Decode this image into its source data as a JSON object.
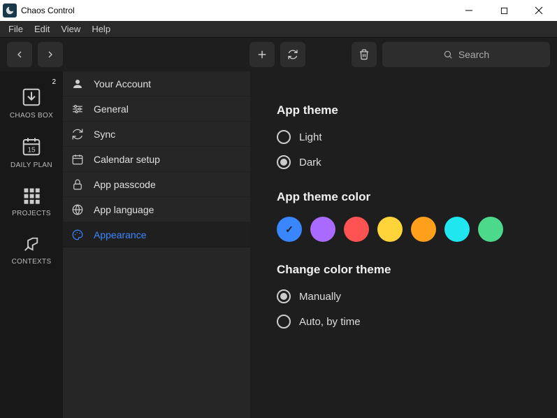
{
  "titlebar": {
    "title": "Chaos Control"
  },
  "menubar": [
    "File",
    "Edit",
    "View",
    "Help"
  ],
  "search": {
    "placeholder": "Search"
  },
  "leftnav": [
    {
      "label": "CHAOS BOX",
      "icon": "inbox",
      "badge": "2"
    },
    {
      "label": "DAILY PLAN",
      "icon": "calendar-day",
      "day": "15"
    },
    {
      "label": "PROJECTS",
      "icon": "grid"
    },
    {
      "label": "CONTEXTS",
      "icon": "pin"
    }
  ],
  "settingsnav": [
    {
      "label": "Your Account",
      "icon": "user"
    },
    {
      "label": "General",
      "icon": "sliders"
    },
    {
      "label": "Sync",
      "icon": "sync"
    },
    {
      "label": "Calendar setup",
      "icon": "calendar"
    },
    {
      "label": "App passcode",
      "icon": "lock"
    },
    {
      "label": "App language",
      "icon": "globe"
    },
    {
      "label": "Appearance",
      "icon": "palette",
      "active": true
    }
  ],
  "content": {
    "theme_title": "App theme",
    "theme_options": [
      "Light",
      "Dark"
    ],
    "theme_selected": "Dark",
    "color_title": "App theme color",
    "colors": [
      "#3a86ff",
      "#a96bff",
      "#ff5252",
      "#ffd43b",
      "#ff9f1c",
      "#20e6ef",
      "#4cd98b"
    ],
    "color_selected": 0,
    "change_title": "Change color theme",
    "change_options": [
      "Manually",
      "Auto, by time"
    ],
    "change_selected": "Manually"
  }
}
